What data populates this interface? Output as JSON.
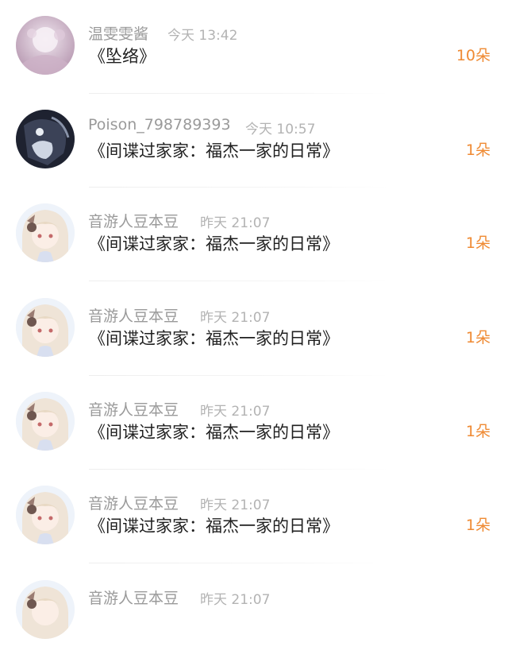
{
  "notifications": [
    {
      "avatar": "pink-lace-avatar",
      "name": "温雯雯酱",
      "time": "今天 13:42",
      "work": "《坠络》",
      "count": "10朵"
    },
    {
      "avatar": "dark-anime-avatar",
      "name": "Poison_798789393",
      "time": "今天 10:57",
      "work": "《间谍过家家：福杰一家的日常》",
      "count": "1朵"
    },
    {
      "avatar": "anime-girl-avatar",
      "name": "音游人豆本豆",
      "time": "昨天 21:07",
      "work": "《间谍过家家：福杰一家的日常》",
      "count": "1朵"
    },
    {
      "avatar": "anime-girl-avatar",
      "name": "音游人豆本豆",
      "time": "昨天 21:07",
      "work": "《间谍过家家：福杰一家的日常》",
      "count": "1朵"
    },
    {
      "avatar": "anime-girl-avatar",
      "name": "音游人豆本豆",
      "time": "昨天 21:07",
      "work": "《间谍过家家：福杰一家的日常》",
      "count": "1朵"
    },
    {
      "avatar": "anime-girl-avatar",
      "name": "音游人豆本豆",
      "time": "昨天 21:07",
      "work": "《间谍过家家：福杰一家的日常》",
      "count": "1朵"
    },
    {
      "avatar": "anime-girl-avatar",
      "name": "音游人豆本豆",
      "time": "昨天 21:07",
      "work": "",
      "count": ""
    }
  ],
  "colors": {
    "count": "#ef8a33",
    "name": "#9a9a9a",
    "time": "#b3b3b3",
    "work": "#1f1f1f"
  }
}
